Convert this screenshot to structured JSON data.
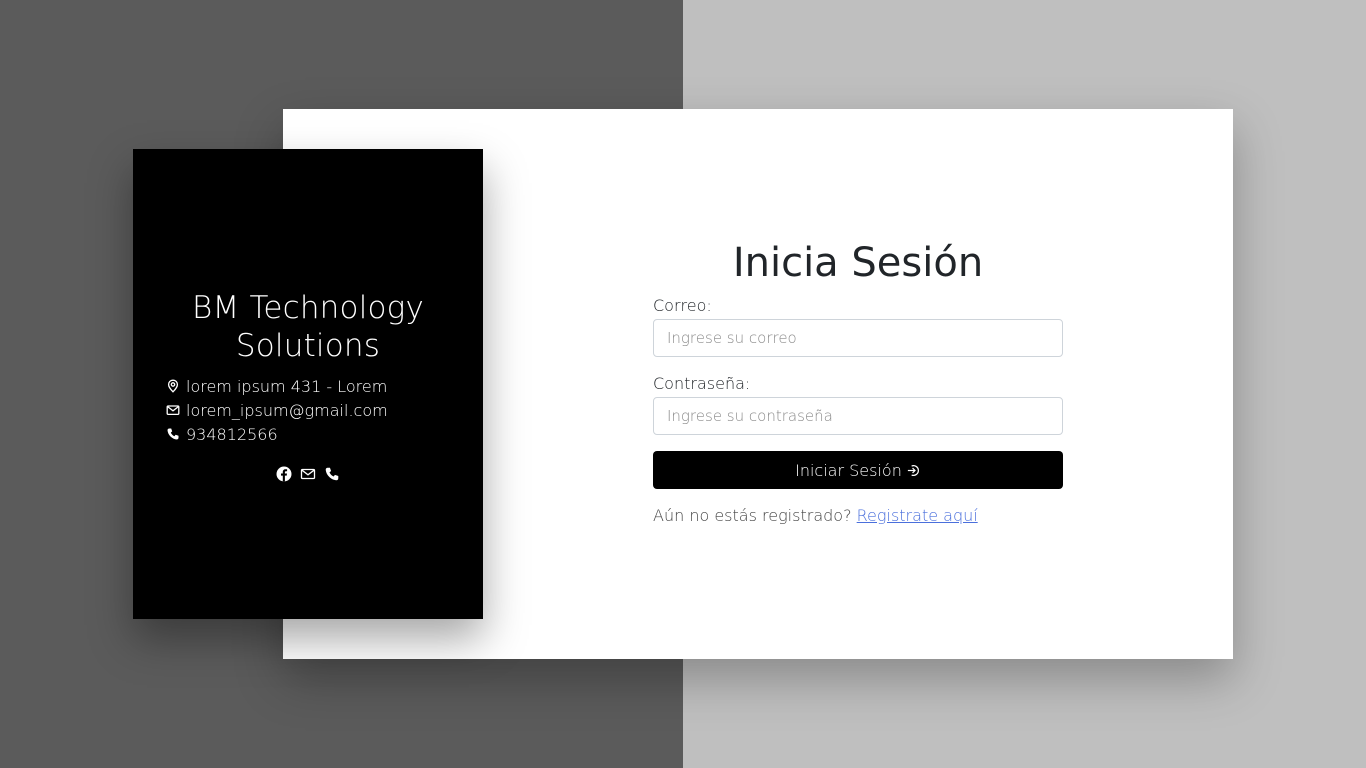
{
  "company": {
    "name_line1": "BM Technology",
    "name_line2": "Solutions",
    "address": "lorem ipsum 431 - Lorem",
    "email": "lorem_ipsum@gmail.com",
    "phone": "934812566"
  },
  "social": {
    "icons": [
      "facebook-icon",
      "mail-icon",
      "phone-icon"
    ]
  },
  "login": {
    "title": "Inicia Sesión",
    "email_label": "Correo:",
    "email_placeholder": "Ingrese su correo",
    "email_value": "",
    "password_label": "Contraseña:",
    "password_placeholder": "Ingrese su contraseña",
    "password_value": "",
    "submit_label": "Iniciar Sesión",
    "register_prompt": "Aún no estás registrado?",
    "register_link": "Registrate aquí"
  },
  "colors": {
    "background_left": "#5b5b5b",
    "background_right": "#bfbfbf",
    "card": "#ffffff",
    "info_card": "#000000",
    "button": "#000000",
    "link": "#4a6fdc"
  }
}
